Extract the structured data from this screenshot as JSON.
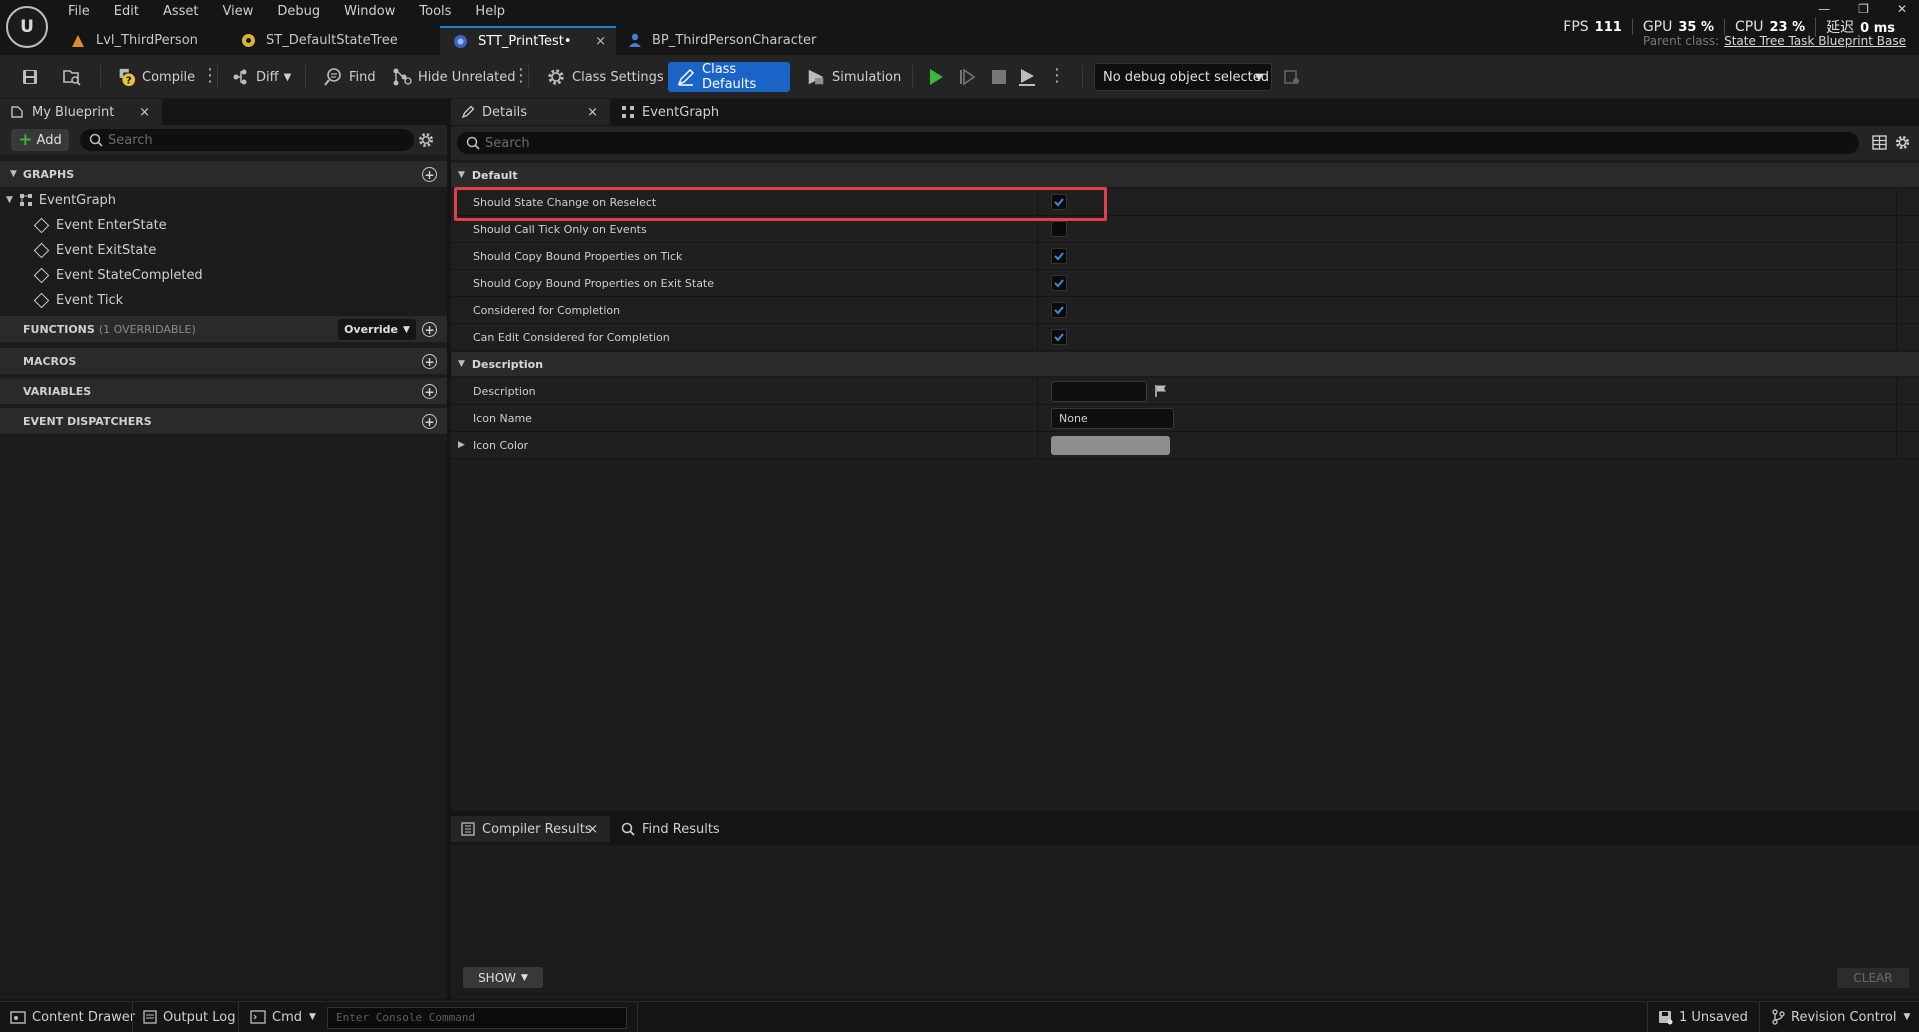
{
  "app": {
    "logo_text": "U",
    "menu": [
      "File",
      "Edit",
      "Asset",
      "View",
      "Debug",
      "Window",
      "Tools",
      "Help"
    ],
    "doc_tabs": [
      {
        "label": "Lvl_ThirdPerson",
        "icon": "level-icon"
      },
      {
        "label": "ST_DefaultStateTree",
        "icon": "state-tree-icon"
      },
      {
        "label": "STT_PrintTest•",
        "icon": "blueprint-icon",
        "active": true,
        "close": "×"
      },
      {
        "label": "BP_ThirdPersonCharacter",
        "icon": "character-blueprint-icon"
      }
    ],
    "stats": {
      "fps_label": "FPS",
      "fps_value": "111",
      "gpu_label": "GPU",
      "gpu_value": "35 %",
      "cpu_label": "CPU",
      "cpu_value": "23 %",
      "latency_label": "延迟",
      "latency_value": "0 ms"
    },
    "window_controls": {
      "minimize": "—",
      "restore": "❐",
      "close": "✕"
    },
    "parent_class_label": "Parent class:",
    "parent_class_value": "State Tree Task Blueprint Base"
  },
  "toolbar": {
    "compile": "Compile",
    "diff": "Diff",
    "find": "Find",
    "hide_unrelated": "Hide Unrelated",
    "class_settings": "Class Settings",
    "class_defaults": "Class Defaults",
    "simulation": "Simulation",
    "debug_object": "No debug object selected"
  },
  "my_blueprint": {
    "tab_label": "My Blueprint",
    "tab_close": "×",
    "add_label": "Add",
    "search_placeholder": "Search",
    "graphs_label": "GRAPHS",
    "event_graph": "EventGraph",
    "events": [
      "Event EnterState",
      "Event ExitState",
      "Event StateCompleted",
      "Event Tick"
    ],
    "functions_label": "FUNCTIONS",
    "functions_sub": "(1 OVERRIDABLE)",
    "override_label": "Override",
    "macros_label": "MACROS",
    "variables_label": "VARIABLES",
    "event_dispatchers_label": "EVENT DISPATCHERS"
  },
  "details": {
    "tab_label": "Details",
    "tab_close": "×",
    "graph_tab_label": "EventGraph",
    "search_placeholder": "Search",
    "default_category": "Default",
    "default_props": [
      {
        "name": "Should State Change on Reselect",
        "checked": true
      },
      {
        "name": "Should Call Tick Only on Events",
        "checked": false
      },
      {
        "name": "Should Copy Bound Properties on Tick",
        "checked": true
      },
      {
        "name": "Should Copy Bound Properties on Exit State",
        "checked": true
      },
      {
        "name": "Considered for Completion",
        "checked": true
      },
      {
        "name": "Can Edit Considered for Completion",
        "checked": true
      }
    ],
    "description_category": "Description",
    "description_label": "Description",
    "description_value": "",
    "icon_name_label": "Icon Name",
    "icon_name_value": "None",
    "icon_color_label": "Icon Color",
    "icon_color_value": "#8e8e8e"
  },
  "compiler": {
    "tab_label": "Compiler Results",
    "tab_close": "×",
    "find_results_label": "Find Results",
    "show_label": "SHOW",
    "clear_label": "CLEAR"
  },
  "statusbar": {
    "content_drawer": "Content Drawer",
    "output_log": "Output Log",
    "cmd": "Cmd",
    "console_placeholder": "Enter Console Command",
    "unsaved": "1 Unsaved",
    "revision_control": "Revision Control"
  },
  "colors": {
    "accent": "#1a64c8",
    "highlight_box": "#e0404a",
    "checkbox_check": "#3a8ae0"
  }
}
